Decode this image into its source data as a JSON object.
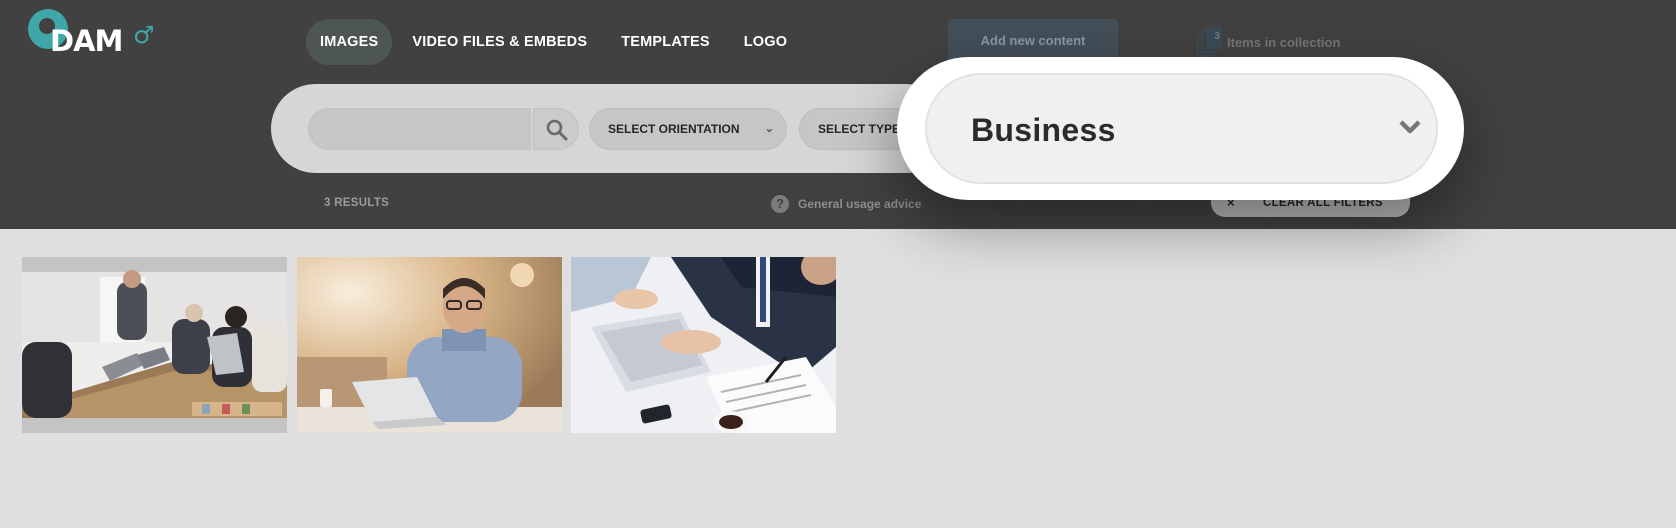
{
  "app": {
    "logo_text": "DAM",
    "logo_glyph": "♂"
  },
  "nav": {
    "items": [
      {
        "label": "IMAGES",
        "active": true
      },
      {
        "label": "VIDEO FILES & EMBEDS",
        "active": false
      },
      {
        "label": "TEMPLATES",
        "active": false
      },
      {
        "label": "LOGO",
        "active": false
      }
    ]
  },
  "header": {
    "add_button_label": "Add new content",
    "collection": {
      "count": "3",
      "label": "Items in collection",
      "icon": "documents-stack-icon"
    }
  },
  "search": {
    "placeholder": "",
    "icon": "search-icon",
    "orientation_label": "SELECT ORIENTATION",
    "type_label": "SELECT TYPE",
    "category_value": "Business"
  },
  "results": {
    "count_text": "3 RESULTS",
    "advice_label": "General usage advice",
    "advice_icon": "question-circle-icon",
    "clear_label": "CLEAR ALL FILTERS",
    "clear_icon": "close-icon"
  },
  "thumbnails": [
    {
      "subject": "business meeting at conference table"
    },
    {
      "subject": "smiling man working on laptop"
    },
    {
      "subject": "business people typing on laptop from above"
    }
  ],
  "colors": {
    "header_bg": "#414141",
    "accent_teal": "#3fa7a8",
    "page_bg": "#dfdfdf"
  }
}
